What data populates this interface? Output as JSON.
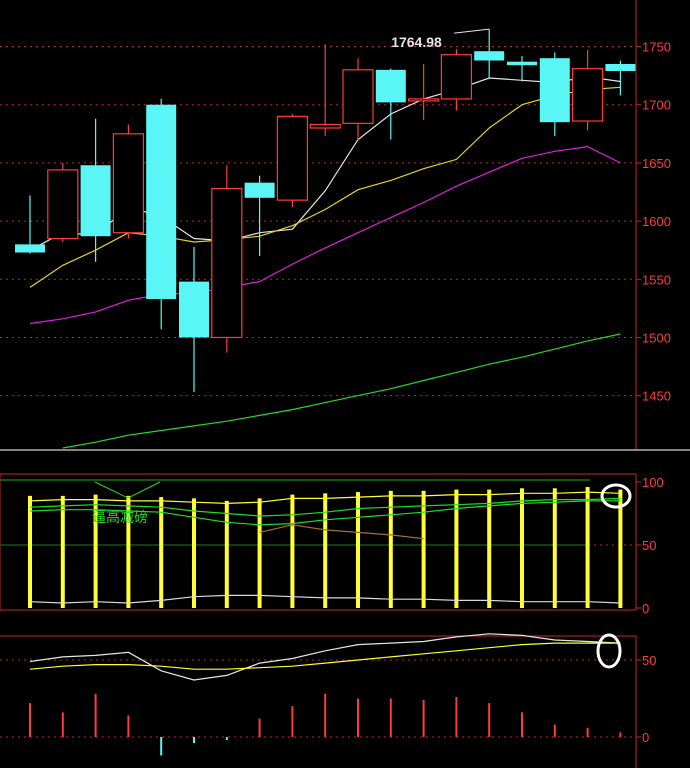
{
  "chart_data": [
    {
      "type": "candlestick",
      "panel": "price",
      "ylim": [
        1405,
        1790
      ],
      "yticks": [
        "1750",
        "1700",
        "1650",
        "1600",
        "1550",
        "1500",
        "1450"
      ],
      "peak_label": "1764.98",
      "candles": [
        {
          "o": 1580,
          "h": 1622,
          "l": 1572,
          "c": 1573
        },
        {
          "o": 1585,
          "h": 1650,
          "l": 1582,
          "c": 1644
        },
        {
          "o": 1648,
          "h": 1688,
          "l": 1565,
          "c": 1587
        },
        {
          "o": 1590,
          "h": 1683,
          "l": 1585,
          "c": 1675
        },
        {
          "o": 1700,
          "h": 1705,
          "l": 1507,
          "c": 1533
        },
        {
          "o": 1548,
          "h": 1578,
          "l": 1453,
          "c": 1500
        },
        {
          "o": 1500,
          "h": 1648,
          "l": 1487,
          "c": 1628
        },
        {
          "o": 1633,
          "h": 1639,
          "l": 1570,
          "c": 1620
        },
        {
          "o": 1618,
          "h": 1692,
          "l": 1612,
          "c": 1690
        },
        {
          "o": 1680,
          "h": 1752,
          "l": 1673,
          "c": 1683
        },
        {
          "o": 1684,
          "h": 1740,
          "l": 1670,
          "c": 1730
        },
        {
          "o": 1730,
          "h": 1731,
          "l": 1670,
          "c": 1702
        },
        {
          "o": 1704,
          "h": 1735,
          "l": 1687,
          "c": 1705
        },
        {
          "o": 1705,
          "h": 1748,
          "l": 1695,
          "c": 1743
        },
        {
          "o": 1746,
          "h": 1764.98,
          "l": 1722,
          "c": 1738
        },
        {
          "o": 1737,
          "h": 1742,
          "l": 1720,
          "c": 1734
        },
        {
          "o": 1740,
          "h": 1745,
          "l": 1673,
          "c": 1685
        },
        {
          "o": 1686,
          "h": 1747,
          "l": 1678,
          "c": 1731
        },
        {
          "o": 1735,
          "h": 1738,
          "l": 1708,
          "c": 1729
        }
      ],
      "series": [
        {
          "color": "#e6e6e6",
          "values": [
            1575,
            1590,
            1588,
            1612,
            1604,
            1585,
            1583,
            1590,
            1593,
            1626,
            1670,
            1692,
            1705,
            1713,
            1723,
            1721,
            1719,
            1724,
            1720
          ]
        },
        {
          "color": "#e6d21e",
          "values": [
            1543,
            1562,
            1575,
            1590,
            1587,
            1582,
            1584,
            1587,
            1596,
            1610,
            1627,
            1635,
            1645,
            1653,
            1680,
            1700,
            1708,
            1713,
            1715
          ]
        },
        {
          "color": "#e020e0",
          "values": [
            1512,
            1516,
            1522,
            1532,
            1537,
            1538,
            1543,
            1548,
            1563,
            1577,
            1590,
            1603,
            1616,
            1630,
            1642,
            1654,
            1660,
            1664,
            1650
          ]
        },
        {
          "color": "#2ad62a",
          "values": [
            null,
            1405,
            1410,
            1416,
            1420,
            1424,
            1428,
            1433,
            1438,
            1444,
            1450,
            1456,
            1463,
            1470,
            1477,
            1483,
            1490,
            1497,
            1503
          ]
        }
      ]
    },
    {
      "type": "bar+line",
      "panel": "indicator-1",
      "ylim": [
        0,
        100
      ],
      "yticks": [
        "100",
        "50",
        "0"
      ],
      "annotation": "逼高减磅",
      "bars": [
        89,
        89,
        90,
        89,
        88,
        87,
        85,
        87,
        90,
        91,
        92,
        93,
        93,
        94,
        94,
        95,
        95,
        96,
        94
      ],
      "series": [
        {
          "color": "#22dd22",
          "values": [
            80,
            81,
            82,
            81,
            80,
            77,
            75,
            73,
            74,
            76,
            79,
            80,
            81,
            82,
            83,
            85,
            86,
            86,
            87
          ]
        },
        {
          "color": "#22dd22",
          "values": [
            77,
            78,
            78,
            77,
            76,
            72,
            68,
            66,
            67,
            70,
            72,
            74,
            76,
            79,
            81,
            83,
            84,
            85,
            85
          ]
        },
        {
          "color": "#ffff33",
          "values": [
            85,
            86,
            86,
            85,
            85,
            84,
            83,
            84,
            87,
            87,
            88,
            89,
            89,
            90,
            90,
            91,
            91,
            92,
            91
          ]
        },
        {
          "color": "#d9d9d9",
          "values": [
            5,
            4,
            5,
            4,
            6,
            9,
            10,
            10,
            9,
            8,
            8,
            7,
            7,
            6,
            6,
            5,
            5,
            5,
            4
          ]
        },
        {
          "color": "#a0742a",
          "values": [
            null,
            null,
            null,
            null,
            null,
            null,
            null,
            60,
            66,
            62,
            60,
            58,
            55,
            null,
            null,
            null,
            null,
            null,
            null
          ]
        }
      ],
      "marker_color": "#ffffff"
    },
    {
      "type": "bar+line",
      "panel": "indicator-2",
      "ylim": [
        -15,
        80
      ],
      "yticks": [
        "50",
        "0"
      ],
      "bars": [
        22,
        16,
        28,
        14,
        -12,
        -4,
        -2,
        12,
        20,
        28,
        25,
        25,
        24,
        26,
        22,
        16,
        8,
        6,
        3
      ],
      "series": [
        {
          "color": "#e6e6e6",
          "values": [
            49,
            52,
            53,
            55,
            43,
            37,
            40,
            48,
            51,
            56,
            60,
            61,
            62,
            65,
            67,
            66,
            63,
            62,
            61
          ]
        },
        {
          "color": "#ffff33",
          "values": [
            44,
            46,
            47,
            47,
            46,
            44,
            44,
            45,
            46,
            48,
            50,
            52,
            54,
            56,
            58,
            60,
            61,
            61,
            61
          ]
        }
      ],
      "marker_color": "#ffffff"
    }
  ],
  "colors": {
    "background": "#000000",
    "up_candle": "#ff3b3b",
    "down_candle": "#5af5f5",
    "axis": "#c0282a",
    "axis_text": "#ff3b3b",
    "separator": "#b0b0b0",
    "bar_positive": "#ff3b3b",
    "bar_negative": "#5af5f5",
    "indicator_bars": "#ffff33"
  }
}
